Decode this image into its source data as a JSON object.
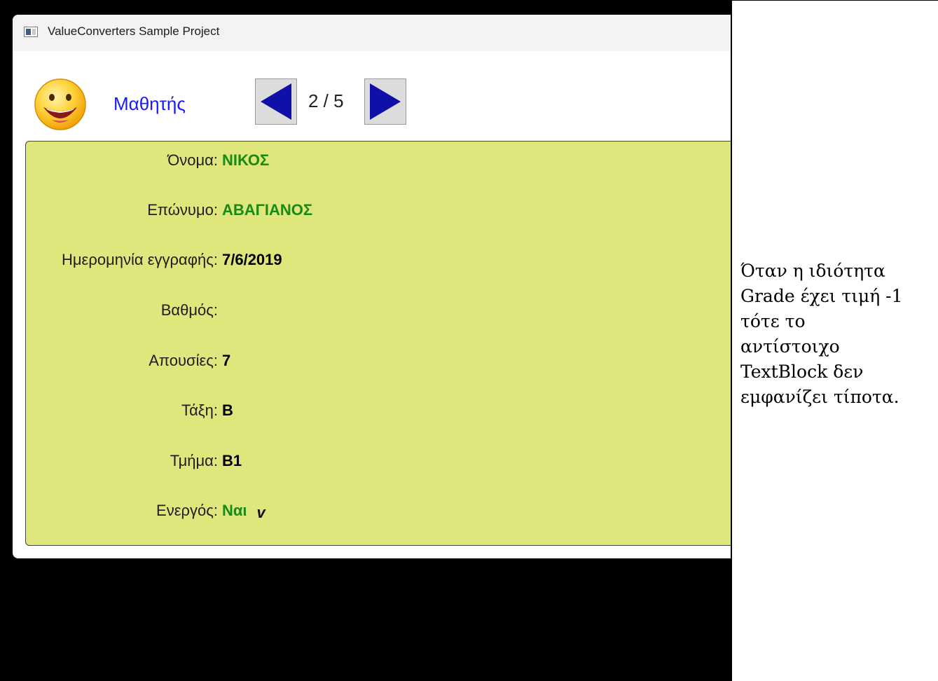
{
  "window": {
    "title": "ValueConverters Sample Project"
  },
  "header": {
    "avatar_icon": "smiley-face-icon",
    "section_title": "Μαθητής",
    "prev_icon": "triangle-left-icon",
    "next_icon": "triangle-right-icon",
    "page_counter": "2 / 5"
  },
  "student": {
    "fields": [
      {
        "label": "Όνομα:",
        "value": "ΝΙΚΟΣ",
        "color": "#178a17"
      },
      {
        "label": "Επώνυμο:",
        "value": "ΑΒΑΓΙΑΝΟΣ",
        "color": "#178a17"
      },
      {
        "label": "Ημερομηνία εγγραφής:",
        "value": "7/6/2019",
        "color": "#000000"
      },
      {
        "label": "Βαθμός:",
        "value": "",
        "color": "#000000"
      },
      {
        "label": "Απουσίες:",
        "value": "7",
        "color": "#000000"
      },
      {
        "label": "Τάξη:",
        "value": "Β",
        "color": "#000000"
      },
      {
        "label": "Τμήμα:",
        "value": "Β1",
        "color": "#000000"
      },
      {
        "label": "Ενεργός:",
        "value": "Ναι",
        "color": "#178a17"
      }
    ],
    "active_check_icon": "checkmark-icon",
    "active_check_glyph": "v"
  },
  "note": {
    "text_lines": [
      "Όταν η ιδιότητα",
      "Grade έχει τιμή -1",
      "τότε το",
      "αντίστοιχο",
      "TextBlock δεν",
      "εμφανίζει τίποτα."
    ]
  },
  "colors": {
    "panel_background": "#dee67c",
    "section_title": "#1a1aff",
    "nav_arrow": "#1010a8",
    "green_value": "#178a17"
  }
}
